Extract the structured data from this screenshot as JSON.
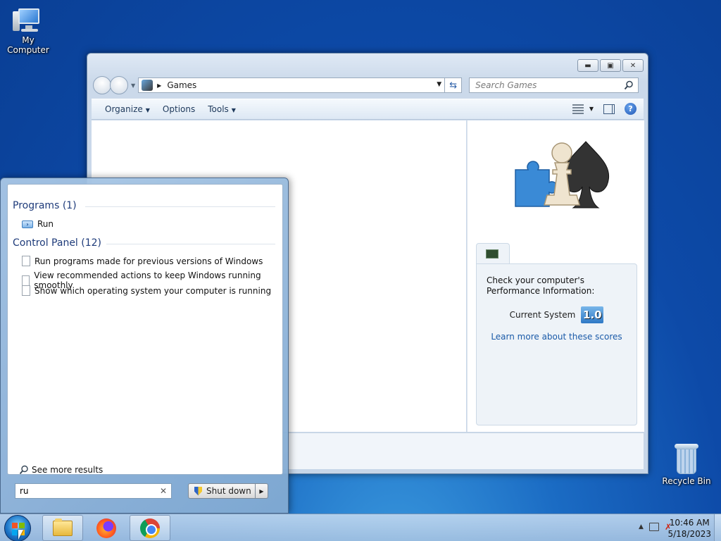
{
  "desktop": {
    "icons": [
      {
        "label": "My Computer",
        "icon": "computer-icon"
      },
      {
        "label": "Recycle Bin",
        "icon": "recycle-bin-icon"
      }
    ]
  },
  "window": {
    "address": {
      "crumb": "Games"
    },
    "search": {
      "placeholder": "Search Games"
    },
    "toolbar": {
      "organize": "Organize",
      "options": "Options",
      "tools": "Tools"
    },
    "preview": {
      "performance": {
        "description": "Check your computer's Performance Information:",
        "system_label": "Current System",
        "score": "1.0",
        "link": "Learn more about these scores"
      }
    }
  },
  "start_menu": {
    "programs": {
      "heading": "Programs (1)",
      "items": [
        {
          "label": "Run"
        }
      ]
    },
    "control_panel": {
      "heading": "Control Panel (12)",
      "items": [
        {
          "label": "Run programs made for previous versions of Windows"
        },
        {
          "label": "View recommended actions to keep Windows running smoothly"
        },
        {
          "label": "Show which operating system your computer is running"
        }
      ]
    },
    "see_more": "See more results",
    "search_value": "ru",
    "shutdown_label": "Shut down"
  },
  "taskbar": {
    "pinned": [
      "file-explorer-icon",
      "firefox-icon",
      "chrome-icon"
    ],
    "clock": {
      "time": "10:46 AM",
      "date": "5/18/2023"
    }
  },
  "colors": {
    "desktop_bg": "#0d4aa8",
    "link": "#1a5aa8",
    "heading": "#1e3b7a"
  }
}
